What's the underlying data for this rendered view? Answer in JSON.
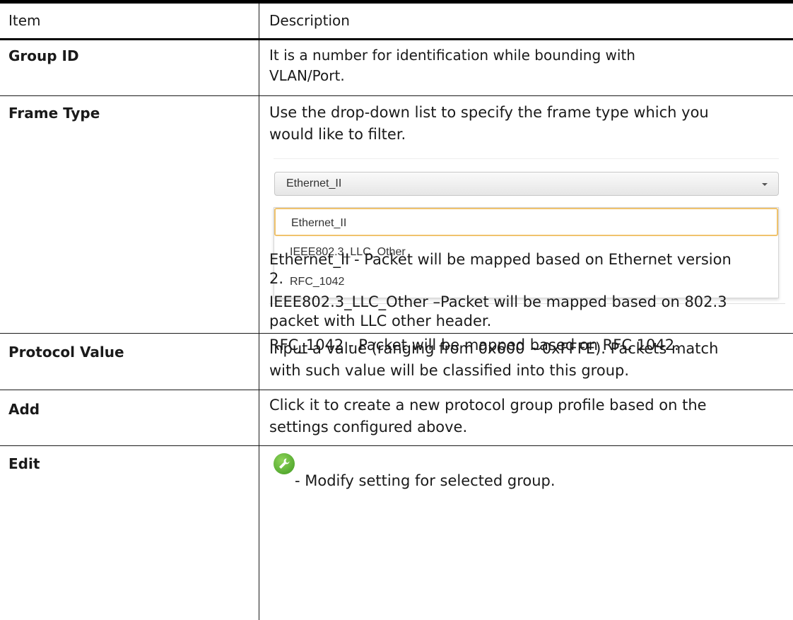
{
  "header": {
    "item": "Item",
    "description": "Description"
  },
  "rows": {
    "group_id": {
      "item": "Group ID",
      "desc_line1": "It is a number for identification while bounding with",
      "desc_line2": "VLAN/Port."
    },
    "frame_type": {
      "item": "Frame Type",
      "desc_line1": "Use the drop-down list to specify the frame type which you",
      "desc_line2": "would like to filter.",
      "dropdown": {
        "selected_value": "Ethernet_II",
        "options": [
          "Ethernet_II",
          "IEEE802.3_LLC_Other",
          "RFC_1042"
        ]
      },
      "notes": {
        "n1_line1": "Ethernet_II - Packet will be mapped based on Ethernet version",
        "n1_line2": "2.",
        "n2_line1": "IEEE802.3_LLC_Other –Packet will be mapped based on 802.3",
        "n2_line2": "packet with LLC other header.",
        "n3": "RFC_1042 - Packet will be mapped based on RFC 1042."
      }
    },
    "protocol_value": {
      "item": "Protocol Value",
      "desc_line1": "Input a value (ranging from 0x600 ~0xFFFE). Packets match",
      "desc_line2": "with such value will be classified into this group."
    },
    "add": {
      "item": "Add",
      "desc_line1": "Click it to create a new protocol group profile based on the",
      "desc_line2": "settings configured above."
    },
    "edit": {
      "item": "Edit",
      "desc": "- Modify setting for selected group.",
      "icon": "wrench-edit-icon"
    }
  },
  "colors": {
    "icon_green": "#4caf2a",
    "selected_border": "#f0c36d"
  }
}
